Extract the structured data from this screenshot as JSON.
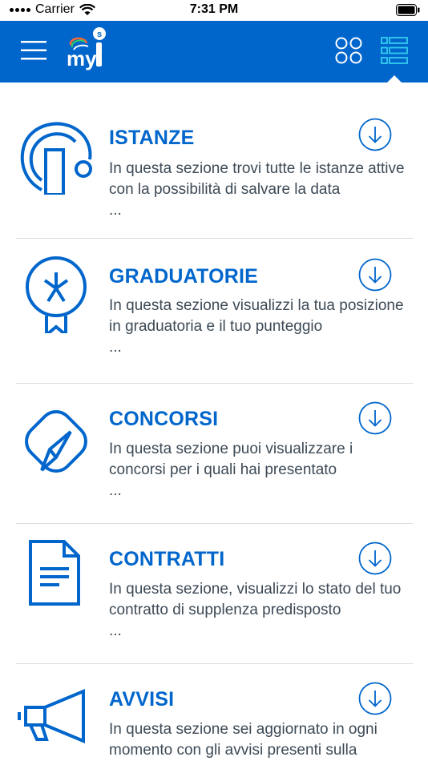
{
  "status_bar": {
    "carrier": "Carrier",
    "time": "7:31 PM"
  },
  "header": {
    "logo_text": "my",
    "logo_badge": "s",
    "accent_color": "#0066cc"
  },
  "sections": [
    {
      "title": "ISTANZE",
      "description": "In questa sezione trovi tutte le istanze attive con la possibilità di salvare la data",
      "ellipsis": "...",
      "icon": "instances-icon"
    },
    {
      "title": "GRADUATORIE",
      "description": "In questa sezione visualizzi la tua posizione in graduatoria e il tuo punteggio",
      "ellipsis": "...",
      "icon": "ribbon-award-icon"
    },
    {
      "title": "CONCORSI",
      "description": "In questa sezione puoi visualizzare i concorsi per i quali hai presentato",
      "ellipsis": "...",
      "icon": "send-icon"
    },
    {
      "title": "CONTRATTI",
      "description": "In questa sezione, visualizzi lo stato del tuo contratto di supplenza predisposto",
      "ellipsis": "...",
      "icon": "document-icon"
    },
    {
      "title": "AVVISI",
      "description": "In questa sezione sei aggiornato in ogni momento con gli avvisi presenti sulla",
      "ellipsis": "",
      "icon": "megaphone-icon"
    }
  ]
}
